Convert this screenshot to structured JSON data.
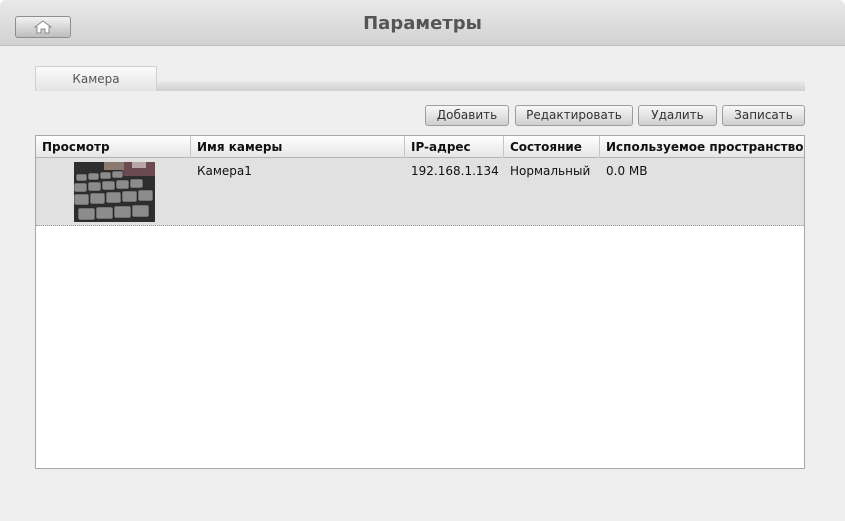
{
  "window": {
    "title": "Параметры"
  },
  "tabs": [
    {
      "label": "Камера"
    }
  ],
  "toolbar": {
    "add_label": "Добавить",
    "edit_label": "Редактировать",
    "delete_label": "Удалить",
    "record_label": "Записать"
  },
  "table": {
    "columns": [
      "Просмотр",
      "Имя камеры",
      "IP-адрес",
      "Состояние",
      "Используемое пространство"
    ],
    "rows": [
      {
        "name": "Камера1",
        "ip": "192.168.1.134",
        "state": "Нормальный",
        "space": "0.0 MB"
      }
    ]
  },
  "icons": {
    "home": "home-icon",
    "preview": "camera-preview-thumbnail"
  }
}
